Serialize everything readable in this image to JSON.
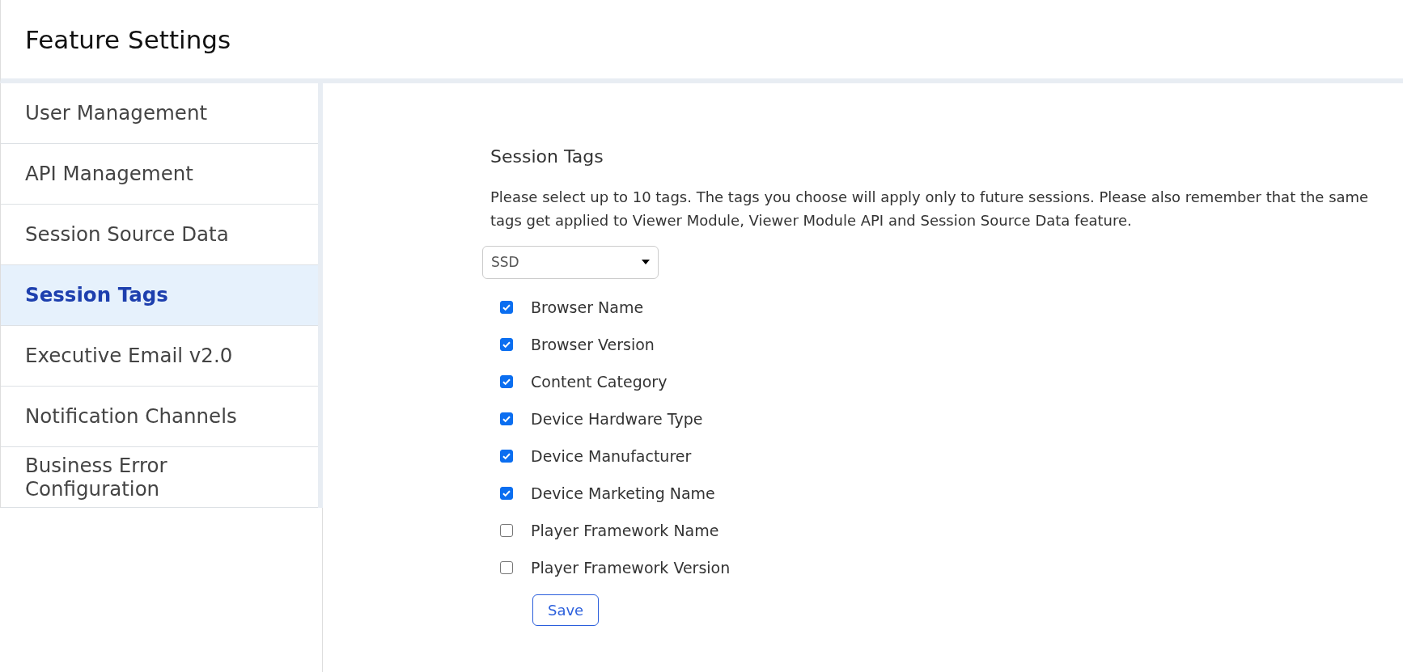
{
  "header": {
    "title": "Feature Settings"
  },
  "sidebar": {
    "items": [
      {
        "label": "User Management",
        "selected": false
      },
      {
        "label": "API Management",
        "selected": false
      },
      {
        "label": "Session Source Data",
        "selected": false
      },
      {
        "label": "Session Tags",
        "selected": true
      },
      {
        "label": "Executive Email v2.0",
        "selected": false
      },
      {
        "label": "Notification Channels",
        "selected": false
      },
      {
        "label": "Business Error Configuration",
        "selected": false
      }
    ]
  },
  "content": {
    "title": "Session Tags",
    "description": "Please select up to 10 tags. The tags you choose will apply only to future sessions. Please also remember that the same tags get applied to Viewer Module, Viewer Module API and Session Source Data feature.",
    "dropdown": {
      "value": "SSD"
    },
    "tags": [
      {
        "label": "Browser Name",
        "checked": true
      },
      {
        "label": "Browser Version",
        "checked": true
      },
      {
        "label": "Content Category",
        "checked": true
      },
      {
        "label": "Device Hardware Type",
        "checked": true
      },
      {
        "label": "Device Manufacturer",
        "checked": true
      },
      {
        "label": "Device Marketing Name",
        "checked": true
      },
      {
        "label": "Player Framework Name",
        "checked": false
      },
      {
        "label": "Player Framework Version",
        "checked": false
      }
    ],
    "save_button": "Save"
  }
}
